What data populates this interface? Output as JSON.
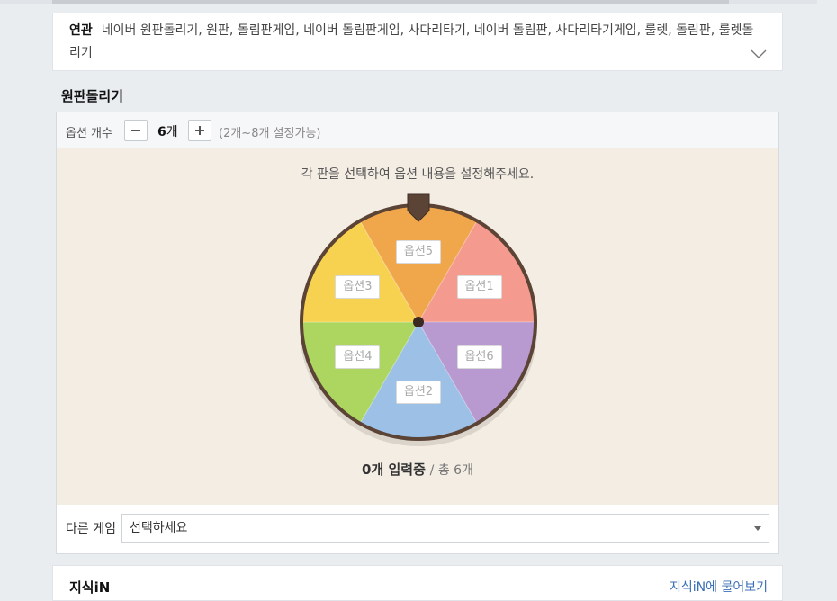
{
  "related": {
    "label": "연관",
    "text": "네이버 원판돌리기, 원판, 돌림판게임, 네이버 돌림판게임, 사다리타기, 네이버 돌림판, 사다리타기게임, 룰렛, 돌림판, 룰렛돌리기",
    "toggle_icon": "chevron-down-icon"
  },
  "section_title": "원판돌리기",
  "options_bar": {
    "label": "옵션 개수",
    "count": "6",
    "count_unit": "개",
    "hint": "(2개~8개 설정가능)"
  },
  "instruction": "각 판을 선택하여 옵션 내용을 설정해주세요.",
  "wheel": {
    "segments": [
      {
        "label": "옵션1",
        "color": "#f59a8f"
      },
      {
        "label": "옵션6",
        "color": "#b89ad1"
      },
      {
        "label": "옵션2",
        "color": "#9cc0e6"
      },
      {
        "label": "옵션4",
        "color": "#acd65f"
      },
      {
        "label": "옵션3",
        "color": "#f7d250"
      },
      {
        "label": "옵션5",
        "color": "#f0a74b"
      }
    ],
    "rim_color": "#5b4436"
  },
  "status": {
    "count": "0개 입력중",
    "total": "/ 총 6개"
  },
  "other_game": {
    "label": "다른 게임",
    "selected": "선택하세요"
  },
  "kin": {
    "title": "지식iN",
    "link": "지식iN에 물어보기"
  }
}
